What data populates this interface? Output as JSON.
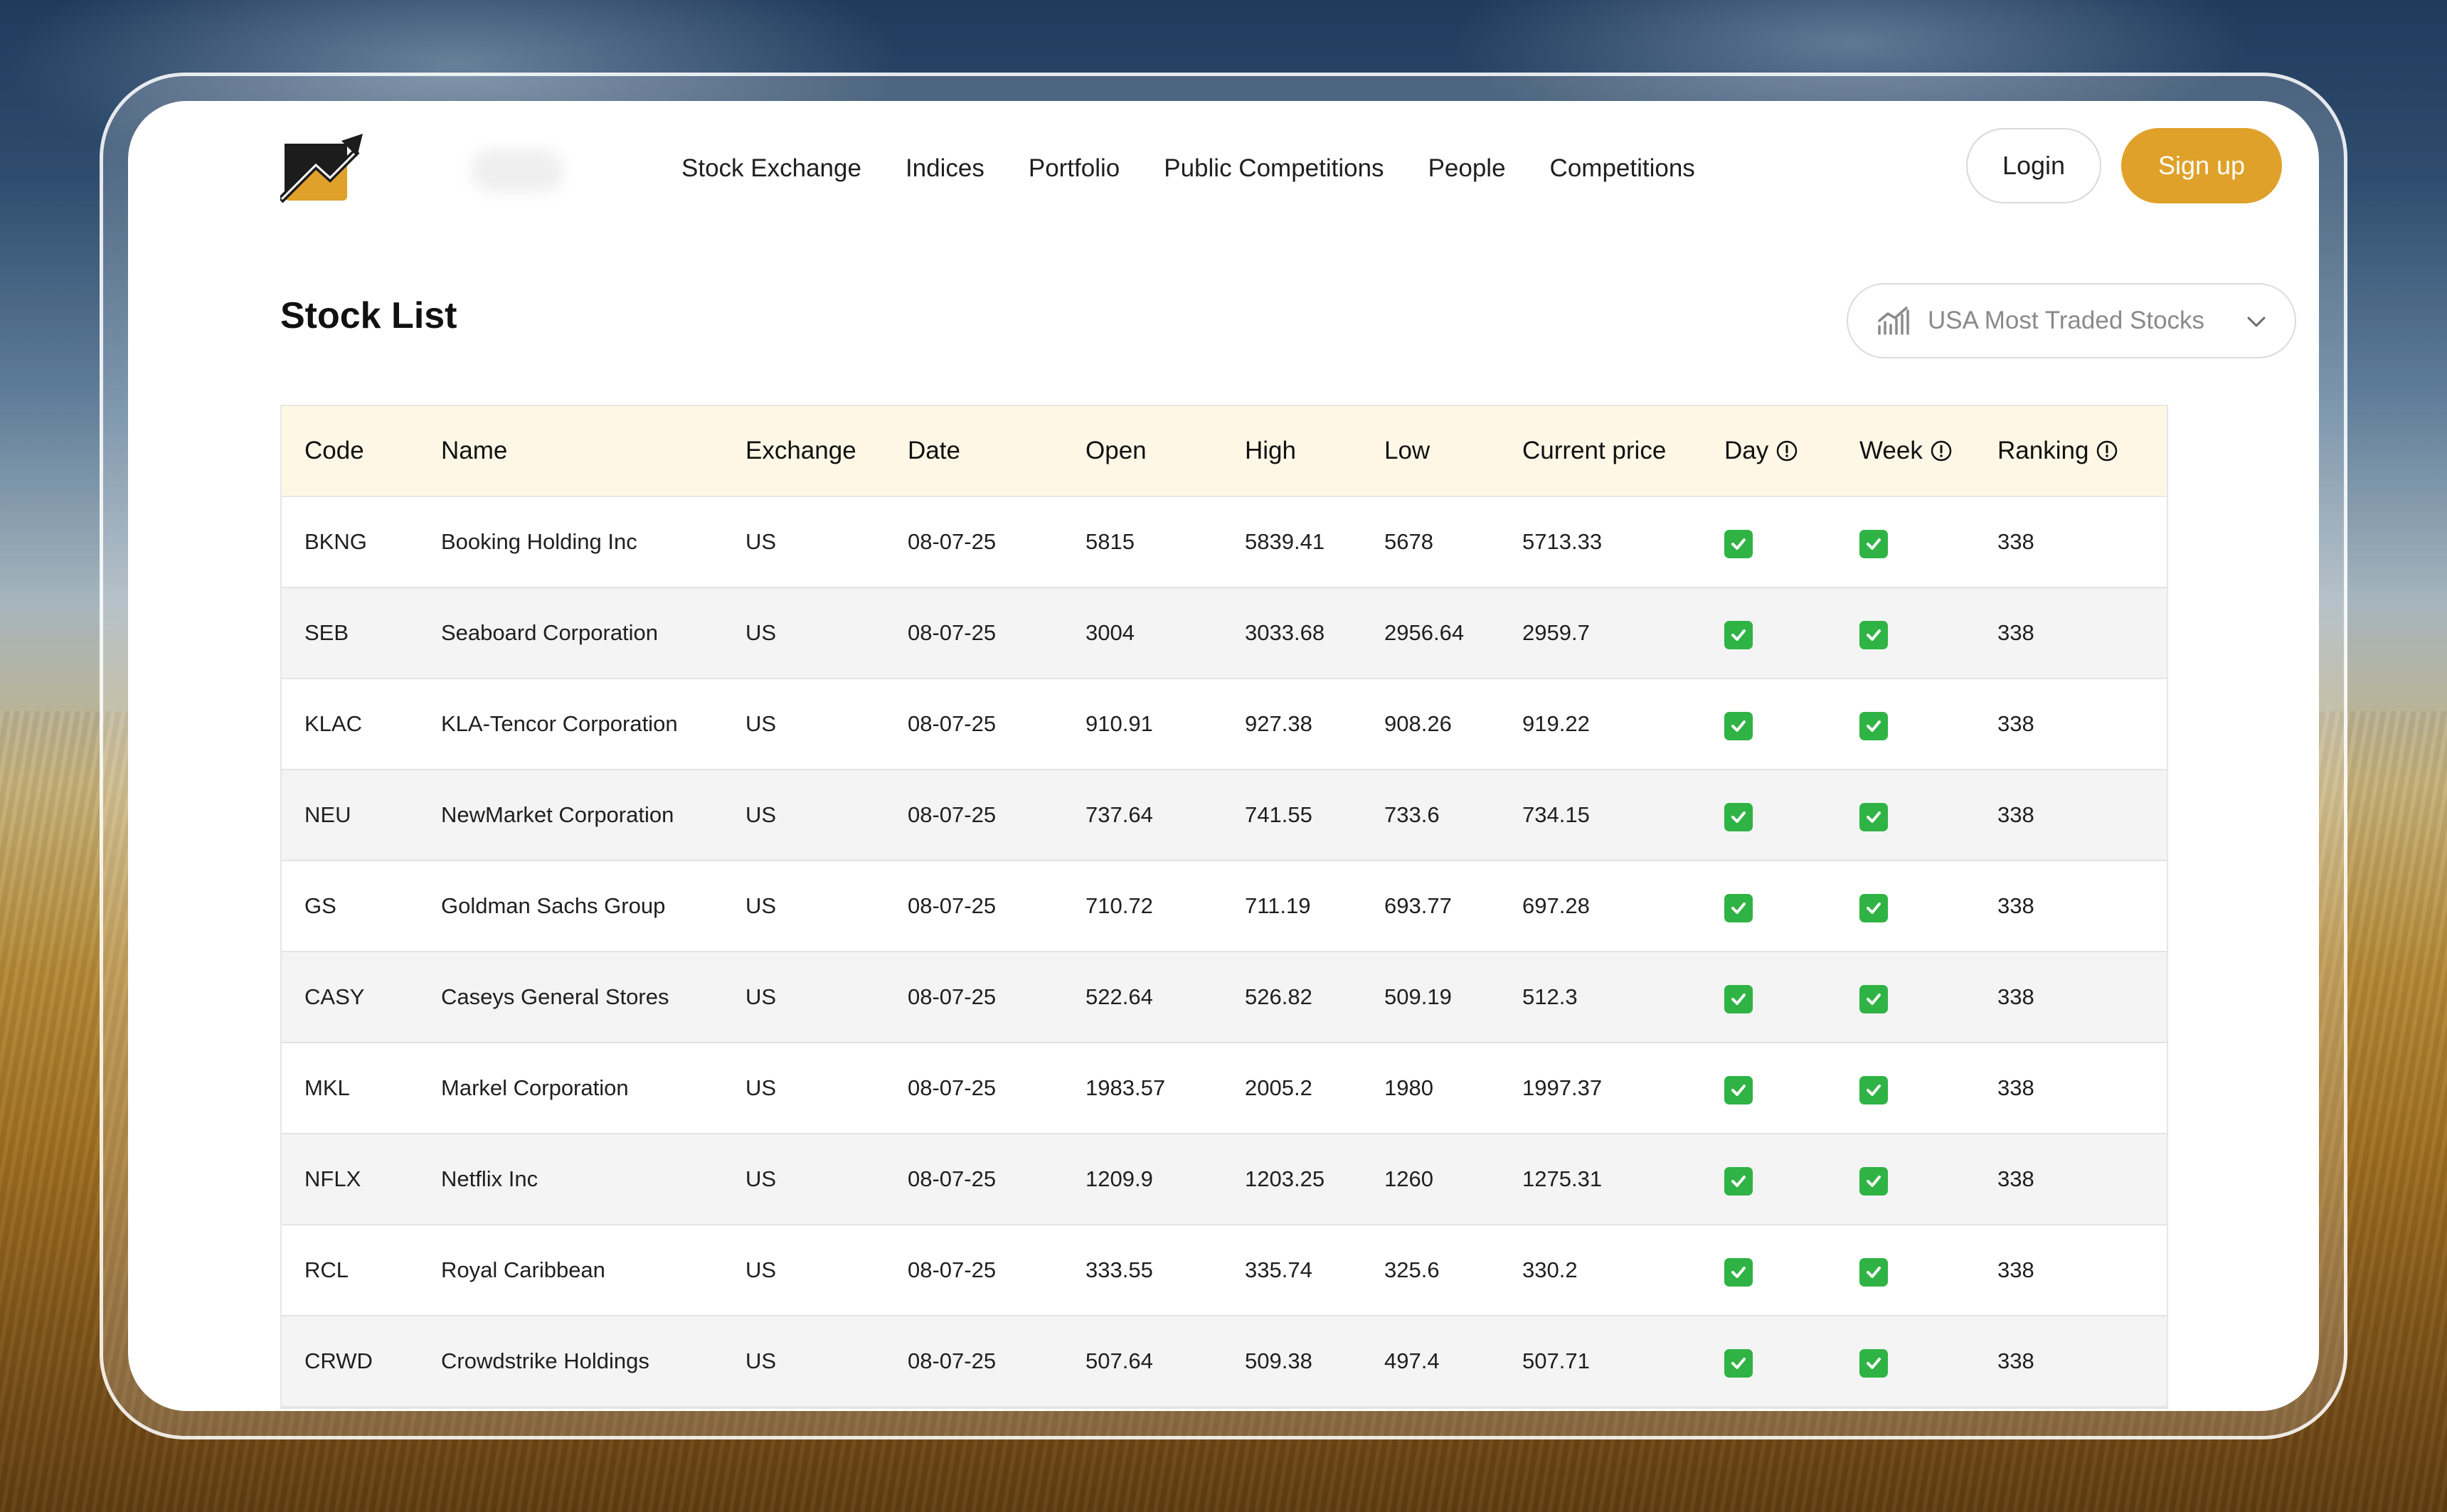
{
  "nav": {
    "items": [
      "Stock Exchange",
      "Indices",
      "Portfolio",
      "Public Competitions",
      "People",
      "Competitions"
    ],
    "login_label": "Login",
    "signup_label": "Sign up"
  },
  "page": {
    "title": "Stock List",
    "dropdown_selected": "USA Most Traded Stocks"
  },
  "colors": {
    "accent": "#dfa12a",
    "header_row": "#fff7e6",
    "check": "#2fb344"
  },
  "table": {
    "headers": {
      "code": "Code",
      "name": "Name",
      "exchange": "Exchange",
      "date": "Date",
      "open": "Open",
      "high": "High",
      "low": "Low",
      "current": "Current price",
      "day": "Day",
      "week": "Week",
      "ranking": "Ranking"
    },
    "rows": [
      {
        "code": "BKNG",
        "name": "Booking Holding Inc",
        "exchange": "US",
        "date": "08-07-25",
        "open": "5815",
        "high": "5839.41",
        "low": "5678",
        "current": "5713.33",
        "day": true,
        "week": true,
        "ranking": "338"
      },
      {
        "code": "SEB",
        "name": "Seaboard Corporation",
        "exchange": "US",
        "date": "08-07-25",
        "open": "3004",
        "high": "3033.68",
        "low": "2956.64",
        "current": "2959.7",
        "day": true,
        "week": true,
        "ranking": "338"
      },
      {
        "code": "KLAC",
        "name": "KLA-Tencor Corporation",
        "exchange": "US",
        "date": "08-07-25",
        "open": "910.91",
        "high": "927.38",
        "low": "908.26",
        "current": "919.22",
        "day": true,
        "week": true,
        "ranking": "338"
      },
      {
        "code": "NEU",
        "name": "NewMarket Corporation",
        "exchange": "US",
        "date": "08-07-25",
        "open": "737.64",
        "high": "741.55",
        "low": "733.6",
        "current": "734.15",
        "day": true,
        "week": true,
        "ranking": "338"
      },
      {
        "code": "GS",
        "name": "Goldman Sachs Group",
        "exchange": "US",
        "date": "08-07-25",
        "open": "710.72",
        "high": "711.19",
        "low": "693.77",
        "current": "697.28",
        "day": true,
        "week": true,
        "ranking": "338"
      },
      {
        "code": "CASY",
        "name": "Caseys General Stores",
        "exchange": "US",
        "date": "08-07-25",
        "open": "522.64",
        "high": "526.82",
        "low": "509.19",
        "current": "512.3",
        "day": true,
        "week": true,
        "ranking": "338"
      },
      {
        "code": "MKL",
        "name": "Markel Corporation",
        "exchange": "US",
        "date": "08-07-25",
        "open": "1983.57",
        "high": "2005.2",
        "low": "1980",
        "current": "1997.37",
        "day": true,
        "week": true,
        "ranking": "338"
      },
      {
        "code": "NFLX",
        "name": "Netflix Inc",
        "exchange": "US",
        "date": "08-07-25",
        "open": "1209.9",
        "high": "1203.25",
        "low": "1260",
        "current": "1275.31",
        "day": true,
        "week": true,
        "ranking": "338"
      },
      {
        "code": "RCL",
        "name": "Royal Caribbean",
        "exchange": "US",
        "date": "08-07-25",
        "open": "333.55",
        "high": "335.74",
        "low": "325.6",
        "current": "330.2",
        "day": true,
        "week": true,
        "ranking": "338"
      },
      {
        "code": "CRWD",
        "name": "Crowdstrike Holdings",
        "exchange": "US",
        "date": "08-07-25",
        "open": "507.64",
        "high": "509.38",
        "low": "497.4",
        "current": "507.71",
        "day": true,
        "week": true,
        "ranking": "338"
      }
    ]
  }
}
